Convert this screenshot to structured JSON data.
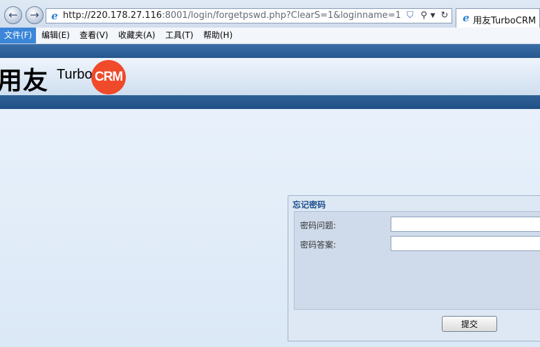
{
  "browser": {
    "url_host": "http://220.178.27.116",
    "url_rest": ":8001/login/forgetpswd.php?ClearS=1&loginname=1",
    "tab_title": "用友TurboCRM",
    "icons": {
      "back": "back-arrow-icon",
      "forward": "forward-arrow-icon",
      "page": "ie-page-icon",
      "compat": "compatibility-shield-icon",
      "search": "search-icon",
      "refresh": "refresh-icon"
    }
  },
  "menu": {
    "items": [
      {
        "label": "文件(F)"
      },
      {
        "label": "编辑(E)"
      },
      {
        "label": "查看(V)"
      },
      {
        "label": "收藏夹(A)"
      },
      {
        "label": "工具(T)"
      },
      {
        "label": "帮助(H)"
      }
    ],
    "active_index": 0
  },
  "header": {
    "logo_cn": "用友",
    "logo_turbo": "Turbo",
    "logo_crm": "CRM",
    "brand_color": "#f04a2a"
  },
  "form": {
    "title": "忘记密码",
    "question_label": "密码问题:",
    "question_value": "",
    "answer_label": "密码答案:",
    "answer_value": "",
    "submit_label": "提交"
  }
}
